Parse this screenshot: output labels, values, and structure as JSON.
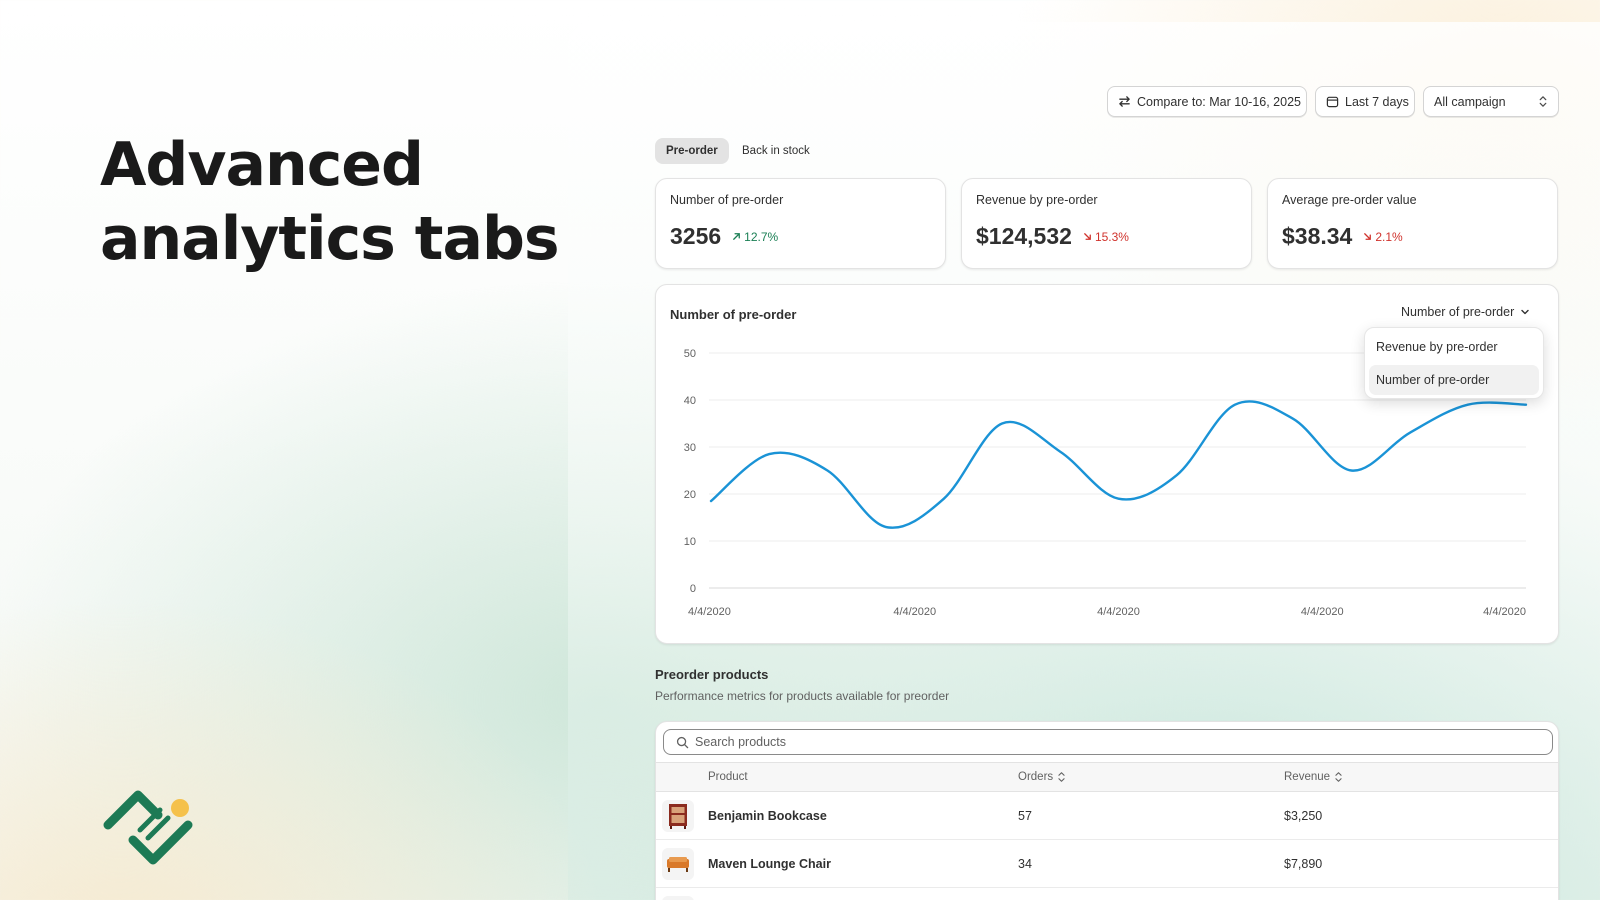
{
  "hero": {
    "title": "Advanced analytics tabs"
  },
  "toolbar": {
    "compare_label": "Compare to: Mar 10-16, 2025",
    "range_label": "Last 7 days",
    "campaign_value": "All campaign"
  },
  "tabs": [
    {
      "label": "Pre-order",
      "active": true
    },
    {
      "label": "Back in stock",
      "active": false
    }
  ],
  "metrics": [
    {
      "label": "Number of pre-order",
      "value": "3256",
      "delta": "12.7%",
      "direction": "up"
    },
    {
      "label": "Revenue by pre-order",
      "value": "$124,532",
      "delta": "15.3%",
      "direction": "down"
    },
    {
      "label": "Average pre-order value",
      "value": "$38.34",
      "delta": "2.1%",
      "direction": "down"
    }
  ],
  "chart": {
    "title": "Number of pre-order",
    "dropdown_label": "Number of pre-order",
    "menu_items": [
      {
        "label": "Revenue by pre-order",
        "selected": false
      },
      {
        "label": "Number of pre-order",
        "selected": true
      }
    ]
  },
  "chart_data": {
    "type": "line",
    "title": "Number of pre-order",
    "xlabel": "",
    "ylabel": "",
    "ylim": [
      0,
      50
    ],
    "y_ticks": [
      0,
      10,
      20,
      30,
      40,
      50
    ],
    "x_tick_labels": [
      "4/4/2020",
      "4/4/2020",
      "4/4/2020",
      "4/4/2020",
      "4/4/2020"
    ],
    "x": [
      0,
      0.5,
      1,
      1.5,
      2,
      2.5,
      3,
      3.5,
      4,
      4.5,
      5,
      5.5,
      6,
      6.5,
      7
    ],
    "series": [
      {
        "values": [
          18.5,
          28.5,
          25,
          13,
          19,
          35,
          29,
          19,
          24,
          39,
          36,
          25,
          33,
          39,
          39
        ],
        "color": "#1a93d6"
      }
    ],
    "grid": true,
    "legend": "none"
  },
  "products_section": {
    "title": "Preorder products",
    "subtitle": "Performance metrics for products available for preorder",
    "search_placeholder": "Search products",
    "columns": [
      "Product",
      "Orders",
      "Revenue"
    ],
    "rows": [
      {
        "name": "Benjamin Bookcase",
        "orders": "57",
        "revenue": "$3,250",
        "icon": "bookcase-icon"
      },
      {
        "name": "Maven Lounge Chair",
        "orders": "34",
        "revenue": "$7,890",
        "icon": "sofa-icon"
      }
    ]
  },
  "colors": {
    "accent_line": "#1a93d6",
    "positive": "#1a7f54",
    "negative": "#d0322c",
    "brand_green": "#1d7a55",
    "brand_yellow": "#f5c14b"
  }
}
